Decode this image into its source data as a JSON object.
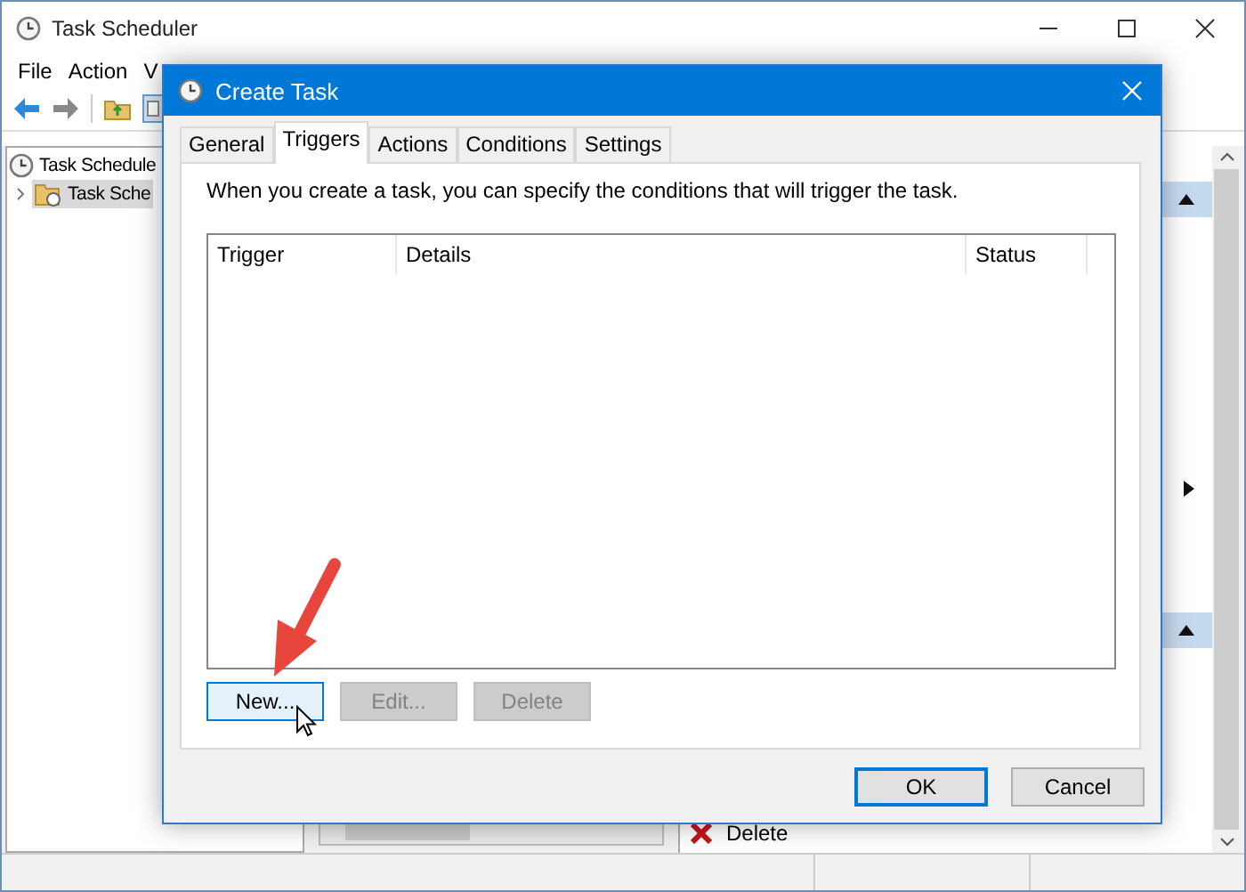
{
  "window": {
    "title": "Task Scheduler",
    "menu": [
      {
        "label": "File"
      },
      {
        "label": "Action"
      },
      {
        "label": "V"
      }
    ]
  },
  "tree": [
    {
      "label": "Task Schedule",
      "selected": false,
      "children": [
        {
          "label": "Task Sche",
          "selected": true,
          "expanded": false
        }
      ]
    }
  ],
  "actions_pane": {
    "items": [
      {
        "label": "Delete"
      }
    ]
  },
  "dialog": {
    "title": "Create Task",
    "tabs": [
      {
        "label": "General",
        "selected": false
      },
      {
        "label": "Triggers",
        "selected": true
      },
      {
        "label": "Actions",
        "selected": false
      },
      {
        "label": "Conditions",
        "selected": false
      },
      {
        "label": "Settings",
        "selected": false
      }
    ],
    "intro": "When you create a task, you can specify the conditions that will trigger the task.",
    "table": {
      "columns": [
        "Trigger",
        "Details",
        "Status"
      ]
    },
    "list_buttons": [
      {
        "label": "New...",
        "disabled": false,
        "hovered": true
      },
      {
        "label": "Edit...",
        "disabled": true,
        "hovered": false
      },
      {
        "label": "Delete",
        "disabled": true,
        "hovered": false
      }
    ],
    "buttons": [
      {
        "label": "OK",
        "default": true
      },
      {
        "label": "Cancel",
        "default": false
      }
    ]
  }
}
